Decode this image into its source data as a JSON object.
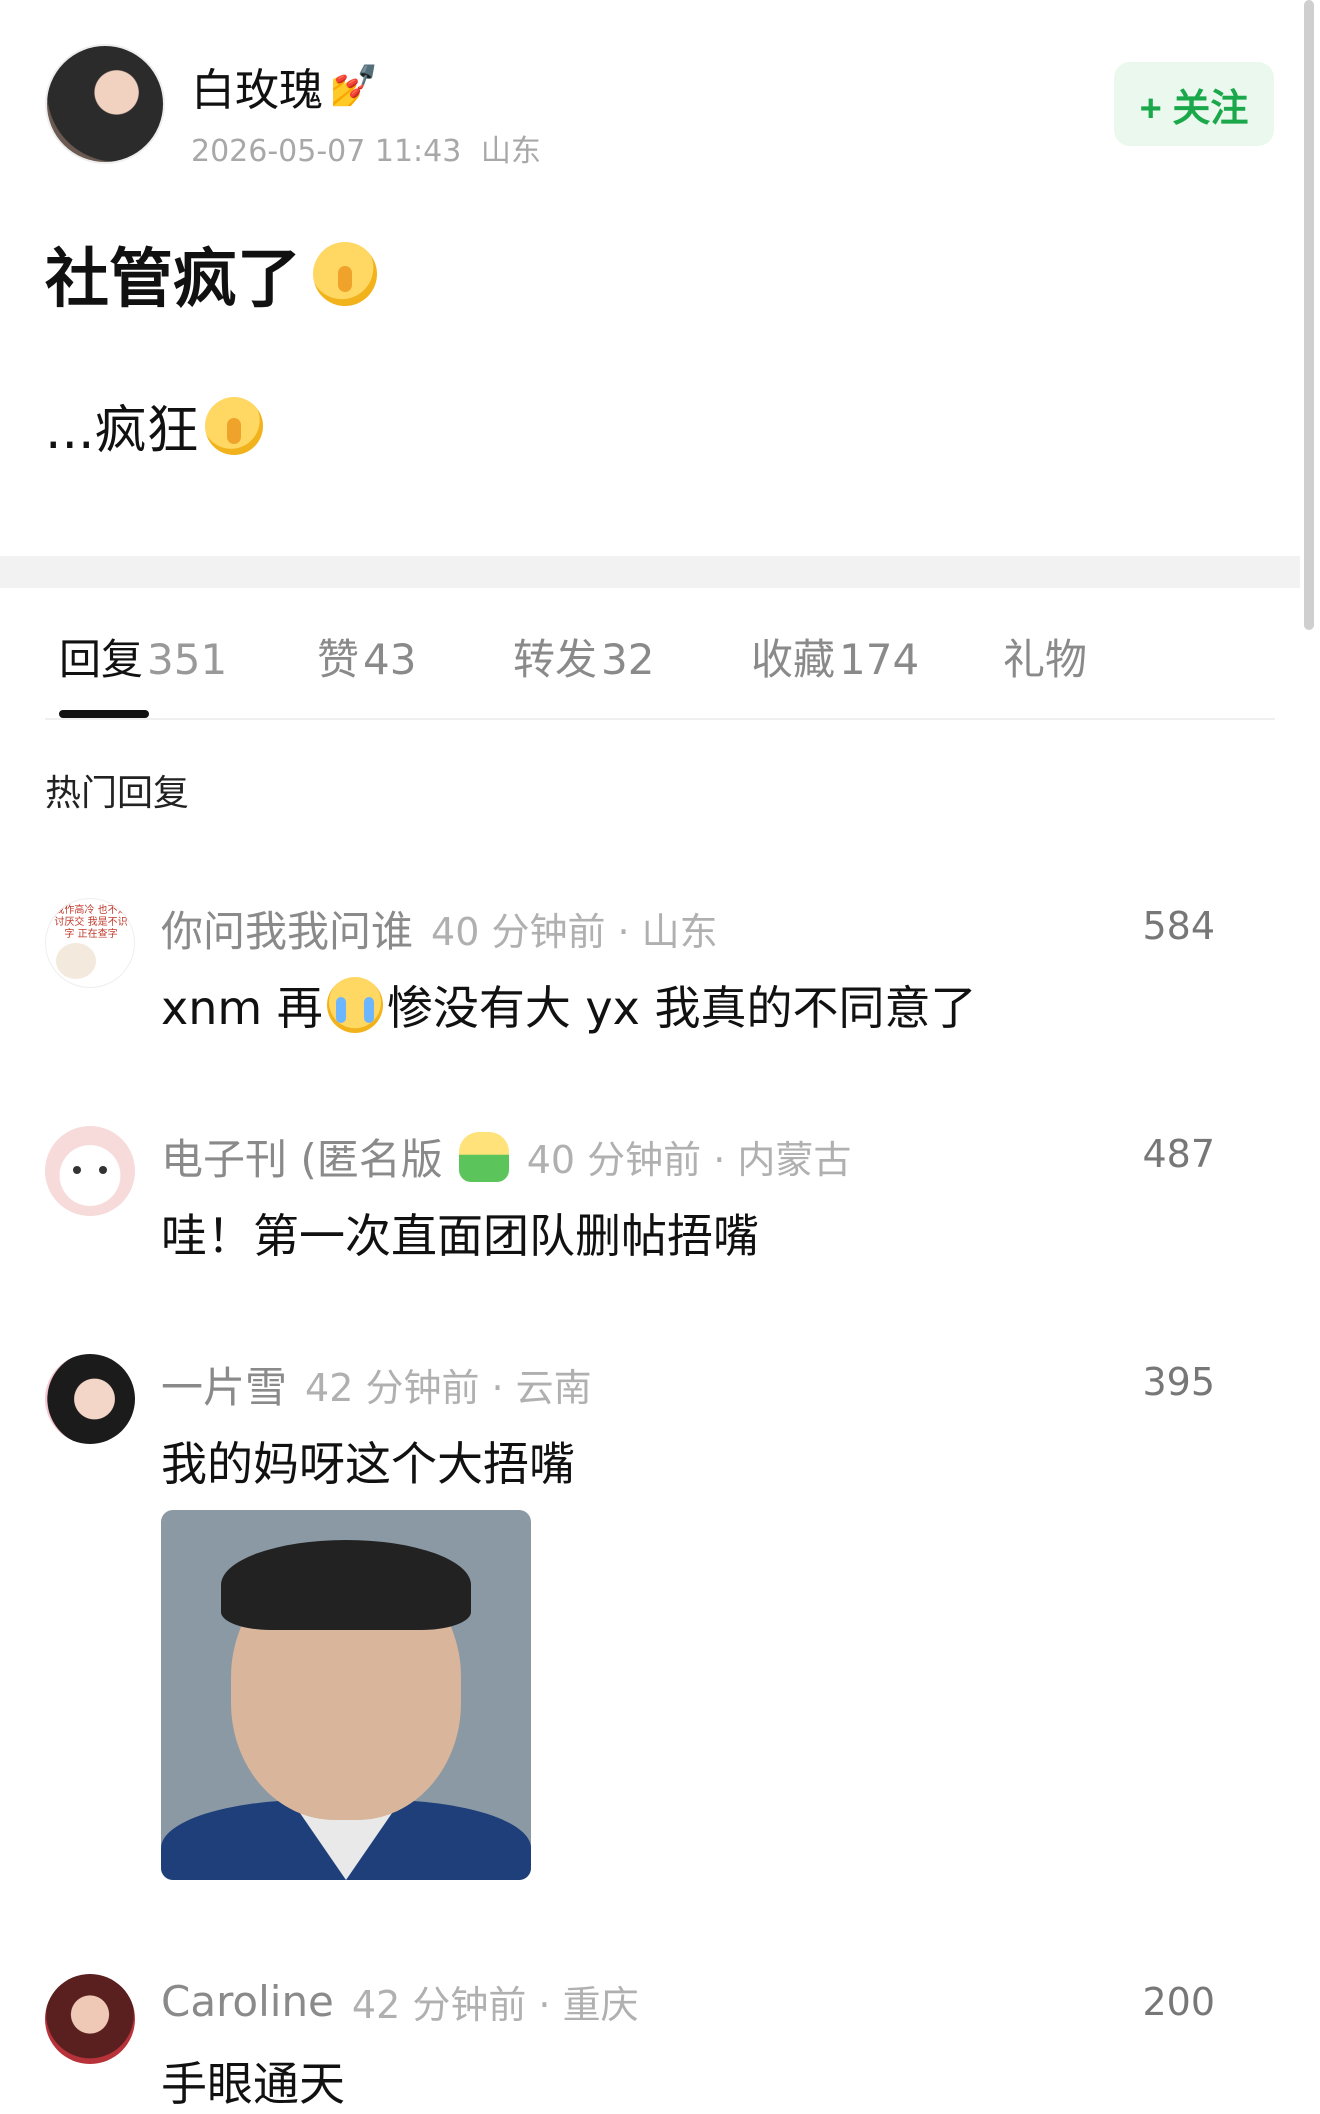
{
  "author": {
    "name": "白玫瑰",
    "name_emoji": "💅",
    "timestamp": "2026-05-07 11:43",
    "location": "山东",
    "follow_label": "+ 关注"
  },
  "post": {
    "title": "社管疯了",
    "body": "...疯狂"
  },
  "tabs": [
    {
      "label": "回复",
      "count": "351"
    },
    {
      "label": "赞",
      "count": "43"
    },
    {
      "label": "转发",
      "count": "32"
    },
    {
      "label": "收藏",
      "count": "174"
    },
    {
      "label": "礼物",
      "count": ""
    }
  ],
  "section_title": "热门回复",
  "comments": [
    {
      "name": "你问我我问谁",
      "meta": "40 分钟前 · 山东",
      "likes": "584",
      "text_a": "xnm 再",
      "text_b": "惨没有大 yx 我真的不同意了",
      "avatar_text": "我作高冷 也不是讨厌交 我是不识字 正在查字"
    },
    {
      "name": "电子刊 (匿名版",
      "meta": "40 分钟前 · 内蒙古",
      "likes": "487",
      "text": "哇！第一次直面团队删帖捂嘴"
    },
    {
      "name": "一片雪",
      "meta": "42 分钟前 · 云南",
      "likes": "395",
      "text": "我的妈呀这个大捂嘴"
    },
    {
      "name": "Caroline",
      "meta": "42 分钟前 · 重庆",
      "likes": "200",
      "text": "手眼通天"
    }
  ],
  "colors": {
    "follow_green": "#1aa84b",
    "follow_bg": "#eaf8ee",
    "muted_text": "#8a8a8a"
  }
}
